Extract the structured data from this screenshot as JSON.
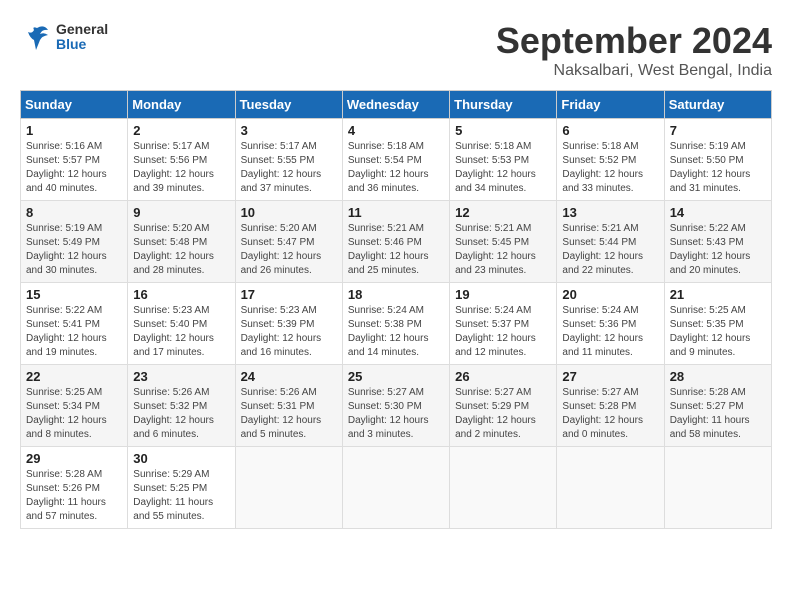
{
  "header": {
    "logo_general": "General",
    "logo_blue": "Blue",
    "month_title": "September 2024",
    "location": "Naksalbari, West Bengal, India"
  },
  "weekdays": [
    "Sunday",
    "Monday",
    "Tuesday",
    "Wednesday",
    "Thursday",
    "Friday",
    "Saturday"
  ],
  "weeks": [
    [
      {
        "day": "1",
        "sunrise": "Sunrise: 5:16 AM",
        "sunset": "Sunset: 5:57 PM",
        "daylight": "Daylight: 12 hours and 40 minutes."
      },
      {
        "day": "2",
        "sunrise": "Sunrise: 5:17 AM",
        "sunset": "Sunset: 5:56 PM",
        "daylight": "Daylight: 12 hours and 39 minutes."
      },
      {
        "day": "3",
        "sunrise": "Sunrise: 5:17 AM",
        "sunset": "Sunset: 5:55 PM",
        "daylight": "Daylight: 12 hours and 37 minutes."
      },
      {
        "day": "4",
        "sunrise": "Sunrise: 5:18 AM",
        "sunset": "Sunset: 5:54 PM",
        "daylight": "Daylight: 12 hours and 36 minutes."
      },
      {
        "day": "5",
        "sunrise": "Sunrise: 5:18 AM",
        "sunset": "Sunset: 5:53 PM",
        "daylight": "Daylight: 12 hours and 34 minutes."
      },
      {
        "day": "6",
        "sunrise": "Sunrise: 5:18 AM",
        "sunset": "Sunset: 5:52 PM",
        "daylight": "Daylight: 12 hours and 33 minutes."
      },
      {
        "day": "7",
        "sunrise": "Sunrise: 5:19 AM",
        "sunset": "Sunset: 5:50 PM",
        "daylight": "Daylight: 12 hours and 31 minutes."
      }
    ],
    [
      {
        "day": "8",
        "sunrise": "Sunrise: 5:19 AM",
        "sunset": "Sunset: 5:49 PM",
        "daylight": "Daylight: 12 hours and 30 minutes."
      },
      {
        "day": "9",
        "sunrise": "Sunrise: 5:20 AM",
        "sunset": "Sunset: 5:48 PM",
        "daylight": "Daylight: 12 hours and 28 minutes."
      },
      {
        "day": "10",
        "sunrise": "Sunrise: 5:20 AM",
        "sunset": "Sunset: 5:47 PM",
        "daylight": "Daylight: 12 hours and 26 minutes."
      },
      {
        "day": "11",
        "sunrise": "Sunrise: 5:21 AM",
        "sunset": "Sunset: 5:46 PM",
        "daylight": "Daylight: 12 hours and 25 minutes."
      },
      {
        "day": "12",
        "sunrise": "Sunrise: 5:21 AM",
        "sunset": "Sunset: 5:45 PM",
        "daylight": "Daylight: 12 hours and 23 minutes."
      },
      {
        "day": "13",
        "sunrise": "Sunrise: 5:21 AM",
        "sunset": "Sunset: 5:44 PM",
        "daylight": "Daylight: 12 hours and 22 minutes."
      },
      {
        "day": "14",
        "sunrise": "Sunrise: 5:22 AM",
        "sunset": "Sunset: 5:43 PM",
        "daylight": "Daylight: 12 hours and 20 minutes."
      }
    ],
    [
      {
        "day": "15",
        "sunrise": "Sunrise: 5:22 AM",
        "sunset": "Sunset: 5:41 PM",
        "daylight": "Daylight: 12 hours and 19 minutes."
      },
      {
        "day": "16",
        "sunrise": "Sunrise: 5:23 AM",
        "sunset": "Sunset: 5:40 PM",
        "daylight": "Daylight: 12 hours and 17 minutes."
      },
      {
        "day": "17",
        "sunrise": "Sunrise: 5:23 AM",
        "sunset": "Sunset: 5:39 PM",
        "daylight": "Daylight: 12 hours and 16 minutes."
      },
      {
        "day": "18",
        "sunrise": "Sunrise: 5:24 AM",
        "sunset": "Sunset: 5:38 PM",
        "daylight": "Daylight: 12 hours and 14 minutes."
      },
      {
        "day": "19",
        "sunrise": "Sunrise: 5:24 AM",
        "sunset": "Sunset: 5:37 PM",
        "daylight": "Daylight: 12 hours and 12 minutes."
      },
      {
        "day": "20",
        "sunrise": "Sunrise: 5:24 AM",
        "sunset": "Sunset: 5:36 PM",
        "daylight": "Daylight: 12 hours and 11 minutes."
      },
      {
        "day": "21",
        "sunrise": "Sunrise: 5:25 AM",
        "sunset": "Sunset: 5:35 PM",
        "daylight": "Daylight: 12 hours and 9 minutes."
      }
    ],
    [
      {
        "day": "22",
        "sunrise": "Sunrise: 5:25 AM",
        "sunset": "Sunset: 5:34 PM",
        "daylight": "Daylight: 12 hours and 8 minutes."
      },
      {
        "day": "23",
        "sunrise": "Sunrise: 5:26 AM",
        "sunset": "Sunset: 5:32 PM",
        "daylight": "Daylight: 12 hours and 6 minutes."
      },
      {
        "day": "24",
        "sunrise": "Sunrise: 5:26 AM",
        "sunset": "Sunset: 5:31 PM",
        "daylight": "Daylight: 12 hours and 5 minutes."
      },
      {
        "day": "25",
        "sunrise": "Sunrise: 5:27 AM",
        "sunset": "Sunset: 5:30 PM",
        "daylight": "Daylight: 12 hours and 3 minutes."
      },
      {
        "day": "26",
        "sunrise": "Sunrise: 5:27 AM",
        "sunset": "Sunset: 5:29 PM",
        "daylight": "Daylight: 12 hours and 2 minutes."
      },
      {
        "day": "27",
        "sunrise": "Sunrise: 5:27 AM",
        "sunset": "Sunset: 5:28 PM",
        "daylight": "Daylight: 12 hours and 0 minutes."
      },
      {
        "day": "28",
        "sunrise": "Sunrise: 5:28 AM",
        "sunset": "Sunset: 5:27 PM",
        "daylight": "Daylight: 11 hours and 58 minutes."
      }
    ],
    [
      {
        "day": "29",
        "sunrise": "Sunrise: 5:28 AM",
        "sunset": "Sunset: 5:26 PM",
        "daylight": "Daylight: 11 hours and 57 minutes."
      },
      {
        "day": "30",
        "sunrise": "Sunrise: 5:29 AM",
        "sunset": "Sunset: 5:25 PM",
        "daylight": "Daylight: 11 hours and 55 minutes."
      },
      null,
      null,
      null,
      null,
      null
    ]
  ]
}
